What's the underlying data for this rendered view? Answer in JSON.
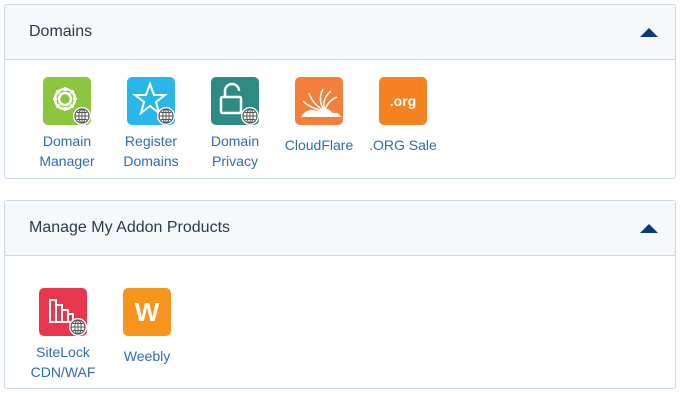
{
  "sections": [
    {
      "title": "Domains",
      "apps": [
        {
          "label_line1": "Domain",
          "label_line2": "Manager",
          "icon": "gear-globe-icon",
          "color": "#8cc63f"
        },
        {
          "label_line1": "Register",
          "label_line2": "Domains",
          "icon": "star-globe-icon",
          "color": "#29b6e8"
        },
        {
          "label_line1": "Domain",
          "label_line2": "Privacy",
          "icon": "lock-globe-icon",
          "color": "#2e8b84"
        },
        {
          "label_line1": "CloudFlare",
          "label_line2": "",
          "icon": "cloudflare-icon",
          "color": "#f47f3a"
        },
        {
          "label_line1": ".ORG Sale",
          "label_line2": "",
          "icon": "org-icon",
          "color": "#f58220",
          "icon_text": ".org"
        }
      ]
    },
    {
      "title": "Manage My Addon Products",
      "apps": [
        {
          "label_line1": "SiteLock",
          "label_line2": "CDN/WAF",
          "icon": "sitelock-icon",
          "color": "#e8364f"
        },
        {
          "label_line1": "Weebly",
          "label_line2": "",
          "icon": "weebly-icon",
          "color": "#f7941d",
          "icon_text": "W"
        }
      ]
    }
  ],
  "colors": {
    "header_bg": "#f6f9fc",
    "border": "#c9d7e6",
    "link": "#2d6cb4",
    "collapse_arrow": "#0a3a7a"
  }
}
